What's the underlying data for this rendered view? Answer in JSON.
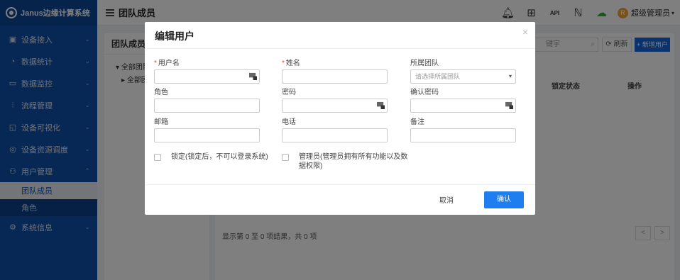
{
  "app": {
    "title": "Janus边缘计算系统"
  },
  "sidebar": {
    "items": [
      {
        "label": "设备接入",
        "icon": "device-icon"
      },
      {
        "label": "数据统计",
        "icon": "stats-icon"
      },
      {
        "label": "数据监控",
        "icon": "monitor-icon"
      },
      {
        "label": "流程管理",
        "icon": "flow-icon"
      },
      {
        "label": "设备可视化",
        "icon": "visual-icon"
      },
      {
        "label": "设备资源调度",
        "icon": "schedule-icon"
      },
      {
        "label": "用户管理",
        "icon": "users-icon"
      }
    ],
    "sub_items": [
      {
        "label": "团队成员",
        "active": true
      },
      {
        "label": "角色",
        "active": false
      }
    ],
    "last_item": {
      "label": "系统信息",
      "icon": "settings-icon"
    }
  },
  "header": {
    "title": "团队成员",
    "user": "超级管理员",
    "avatar_text": "R",
    "icons": [
      "bell-icon",
      "apps-icon",
      "api-icon",
      "nfc-icon",
      "cloud-download-icon"
    ],
    "icon_text": {
      "api": "API"
    }
  },
  "page": {
    "panel_title": "团队成员",
    "tree": [
      "全部团队",
      "全部团队"
    ],
    "search_placeholder": "键字",
    "refresh_label": "刷新",
    "add_label": "+ 新增用户",
    "columns": [
      "锁定状态",
      "操作"
    ],
    "footer": "显示第 0 至 0 项结果，共 0 项",
    "pager_prev": "<",
    "pager_next": ">"
  },
  "modal": {
    "title": "编辑用户",
    "close": "×",
    "fields": {
      "username": {
        "label": "用户名",
        "required": "*"
      },
      "name": {
        "label": "姓名",
        "required": "*"
      },
      "team": {
        "label": "所属团队",
        "placeholder": "请选择所属团队"
      },
      "role": {
        "label": "角色"
      },
      "password": {
        "label": "密码"
      },
      "confirm_password": {
        "label": "确认密码"
      },
      "email": {
        "label": "邮箱"
      },
      "phone": {
        "label": "电话"
      },
      "remark": {
        "label": "备注"
      }
    },
    "lock_label": "锁定(锁定后，不可以登录系统)",
    "admin_label_1": "管理员(管理员拥有所有功能以及数",
    "admin_label_2": "据权限)",
    "cancel_label": "取消",
    "ok_label": "确认"
  }
}
